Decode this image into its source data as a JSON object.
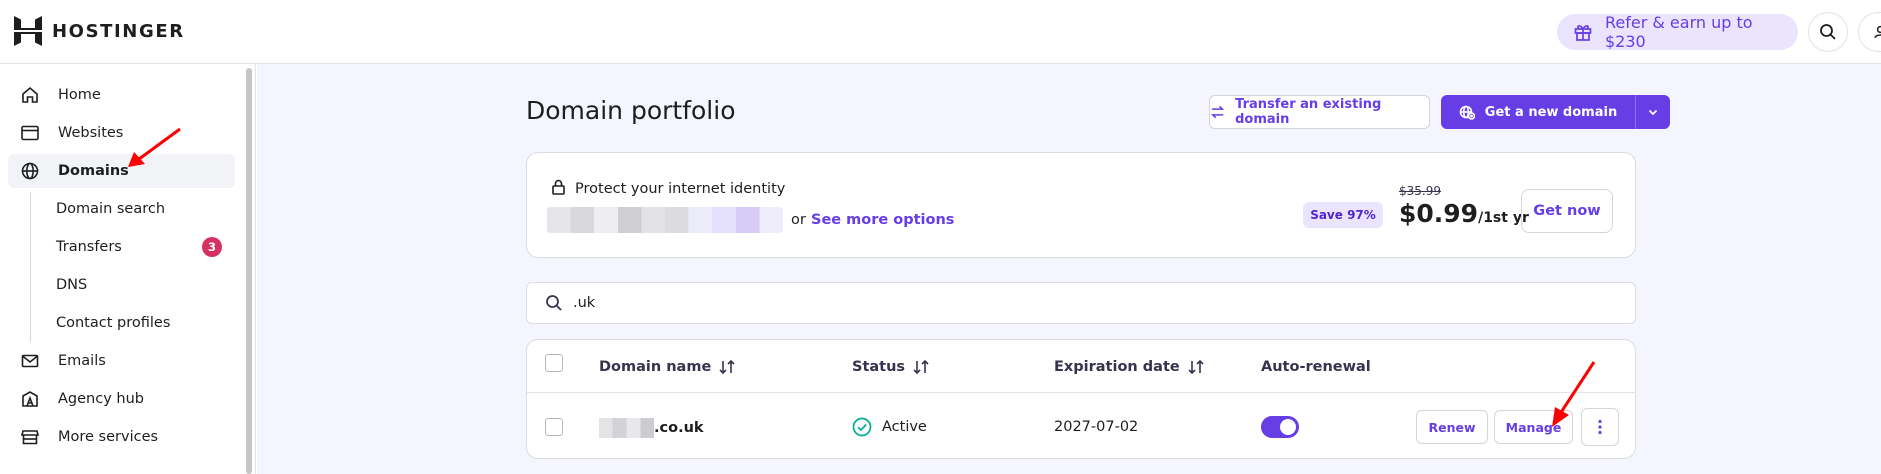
{
  "header": {
    "brand": "HOSTINGER",
    "refer_label": "Refer & earn up to $230",
    "accent_color": "#673de6",
    "icons": [
      "gift-icon",
      "search-icon",
      "user-icon"
    ]
  },
  "sidebar": {
    "items": [
      {
        "label": "Home",
        "icon": "home-icon"
      },
      {
        "label": "Websites",
        "icon": "browser-icon"
      },
      {
        "label": "Domains",
        "icon": "globe-icon",
        "active": true
      },
      {
        "label": "Emails",
        "icon": "mail-icon"
      },
      {
        "label": "Agency hub",
        "icon": "agency-icon"
      },
      {
        "label": "More services",
        "icon": "store-icon"
      }
    ],
    "sub_items": [
      {
        "label": "Domain search"
      },
      {
        "label": "Transfers",
        "badge": "3"
      },
      {
        "label": "DNS"
      },
      {
        "label": "Contact profiles"
      }
    ]
  },
  "main": {
    "title": "Domain portfolio",
    "transfer_label": "Transfer an existing domain",
    "get_domain_label": "Get a new domain"
  },
  "promo": {
    "title": "Protect your internet identity",
    "or_text": "or",
    "more_link": "See more options",
    "save_badge": "Save 97%",
    "old_price": "$35.99",
    "price": "$0.99",
    "price_unit": "/1st yr",
    "cta": "Get now"
  },
  "search": {
    "value": ".uk"
  },
  "table": {
    "columns": [
      "Domain name",
      "Status",
      "Expiration date",
      "Auto-renewal"
    ],
    "rows": [
      {
        "domain_suffix": ".co.uk",
        "status": "Active",
        "expiration": "2027-07-02",
        "auto_renewal": true,
        "renew_label": "Renew",
        "manage_label": "Manage"
      }
    ]
  },
  "status_colors": {
    "active": "#00b090",
    "badge": "#d63163",
    "annotation_arrow": "#ff0000"
  }
}
